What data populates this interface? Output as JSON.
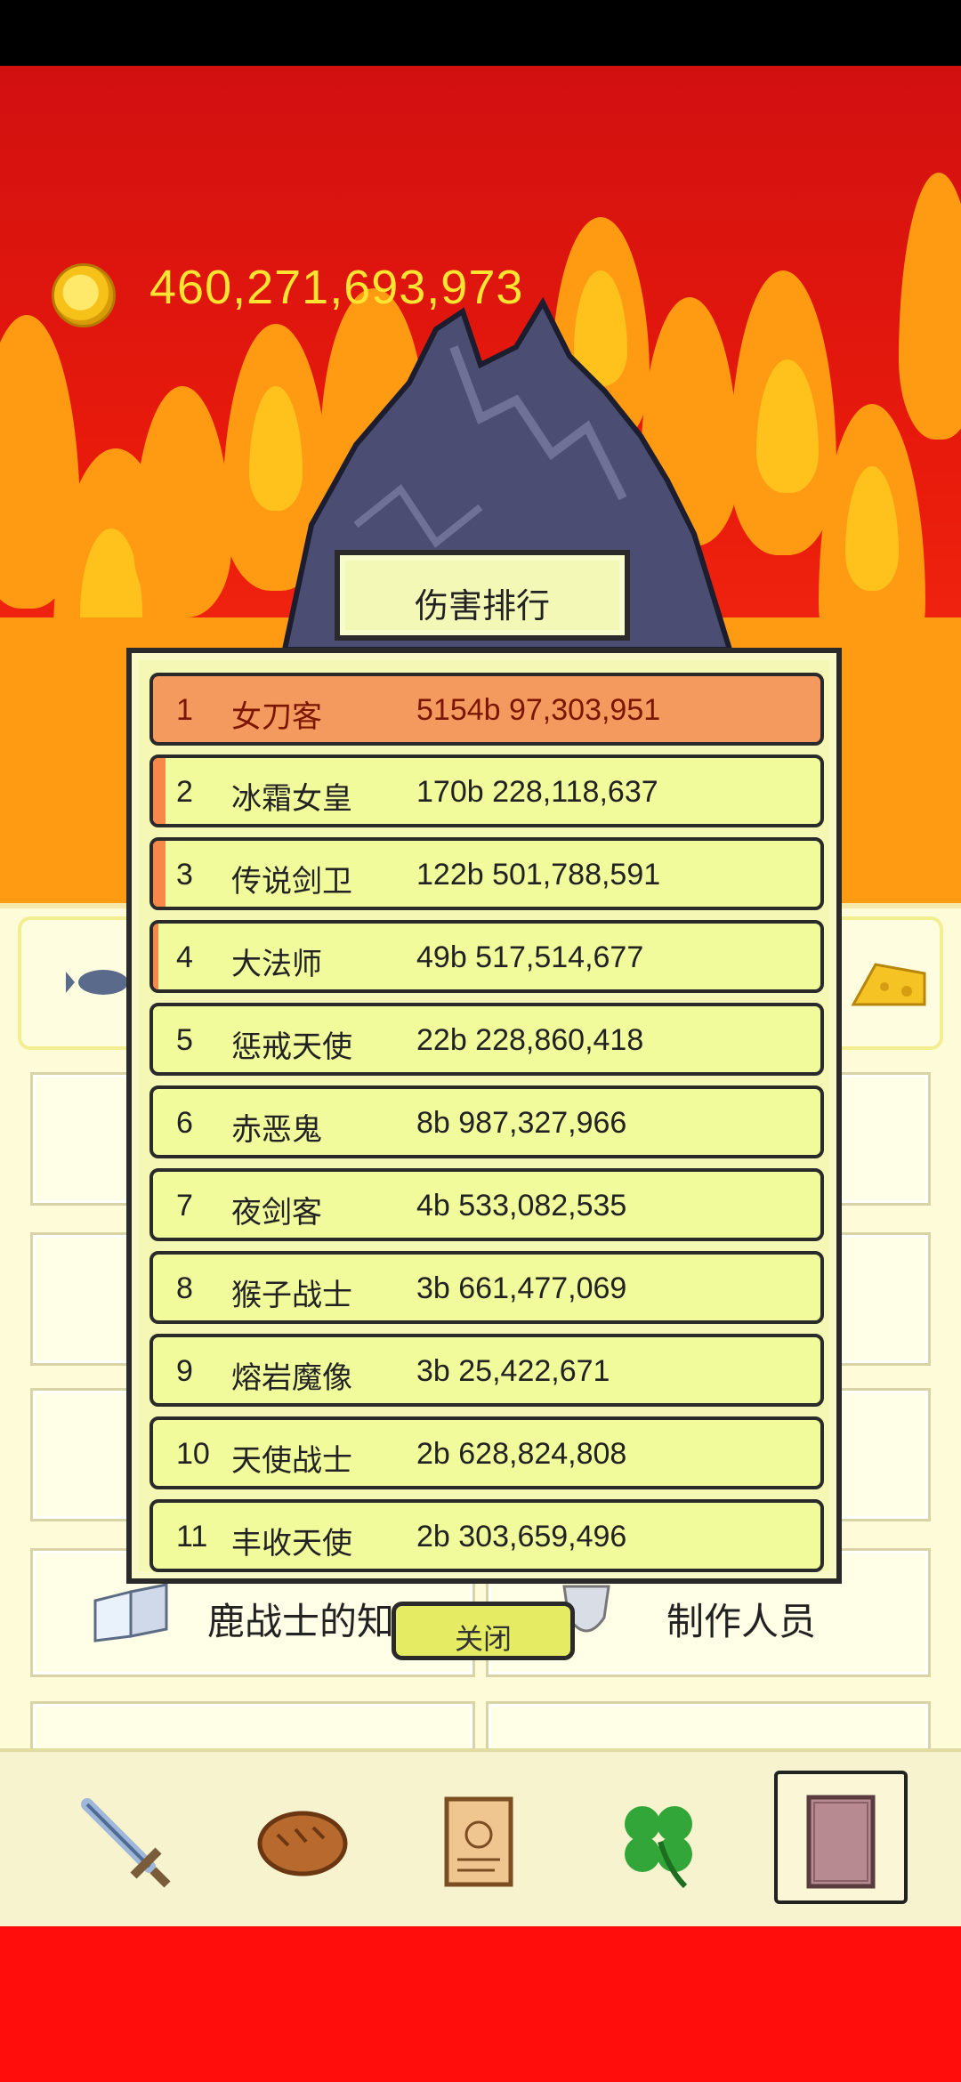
{
  "hud": {
    "gold_amount": "460,271,693,973"
  },
  "ranking": {
    "title": "伤害排行",
    "rows": [
      {
        "rank": "1",
        "name": "女刀客",
        "damage": "5154b 97,303,951"
      },
      {
        "rank": "2",
        "name": "冰霜女皇",
        "damage": "170b 228,118,637"
      },
      {
        "rank": "3",
        "name": "传说剑卫",
        "damage": "122b 501,788,591"
      },
      {
        "rank": "4",
        "name": "大法师",
        "damage": "49b 517,514,677"
      },
      {
        "rank": "5",
        "name": "惩戒天使",
        "damage": "22b 228,860,418"
      },
      {
        "rank": "6",
        "name": "赤恶鬼",
        "damage": "8b 987,327,966"
      },
      {
        "rank": "7",
        "name": "夜剑客",
        "damage": "4b 533,082,535"
      },
      {
        "rank": "8",
        "name": "猴子战士",
        "damage": "3b 661,477,069"
      },
      {
        "rank": "9",
        "name": "熔岩魔像",
        "damage": "3b 25,422,671"
      },
      {
        "rank": "10",
        "name": "天使战士",
        "damage": "2b 628,824,808"
      },
      {
        "rank": "11",
        "name": "丰收天使",
        "damage": "2b 303,659,496"
      }
    ],
    "close_label": "关闭"
  },
  "background_menu": {
    "item_knowledge": "鹿战士的知",
    "item_credits": "制作人员"
  },
  "bottom_nav": {
    "items": [
      "sword-icon",
      "bread-icon",
      "scroll-icon",
      "clover-icon",
      "book-icon"
    ],
    "selected": "book-icon"
  },
  "colors": {
    "sky_red": "#e81a0c",
    "gold_text": "#ffe531",
    "panel_yellow": "#f1fb9c",
    "first_row": "#f59a5e"
  }
}
